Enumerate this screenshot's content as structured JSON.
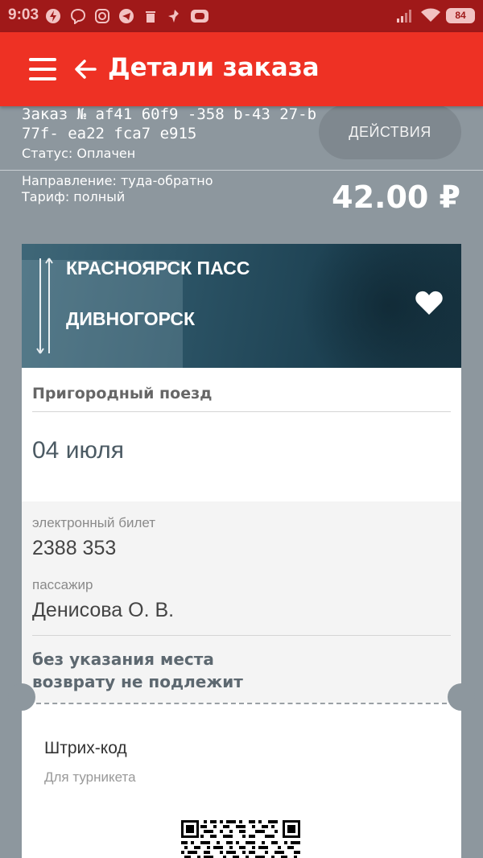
{
  "status_bar": {
    "time": "9:03",
    "battery": "84",
    "icons": [
      "power-icon",
      "viber-icon",
      "instagram-icon",
      "telegram-icon",
      "trash-icon",
      "pin-icon",
      "screen-icon",
      "signal-icon",
      "wifi-icon",
      "battery-icon"
    ]
  },
  "header": {
    "title": "Детали заказа",
    "menu_icon": "menu-icon",
    "back_icon": "back-arrow-icon",
    "color": "#ee3124"
  },
  "order": {
    "number_line1": "Заказ № af41 60f9 -358 b-43 27-b",
    "number_line2": "77f- ea22 fca7 e915",
    "status": "Статус: Оплачен",
    "actions_label": "ДЕЙСТВИЯ",
    "direction": "Направление: туда-обратно",
    "tariff": "Тариф: полный",
    "price": "42.00 ₽"
  },
  "ticket": {
    "from": "КРАСНОЯРСК ПАСС",
    "to": "ДИВНОГОРСК",
    "favorite_icon": "heart-icon",
    "train_type": "Пригородный поезд",
    "date": "04 июля",
    "eticket_label": "электронный билет",
    "eticket_number": "2388 353",
    "passenger_label": "пассажир",
    "passenger_name": "Денисова О. В.",
    "condition1": "без указания места",
    "condition2": "возврату не подлежит",
    "barcode_title": "Штрих-код",
    "barcode_subtitle": "Для турникета"
  }
}
